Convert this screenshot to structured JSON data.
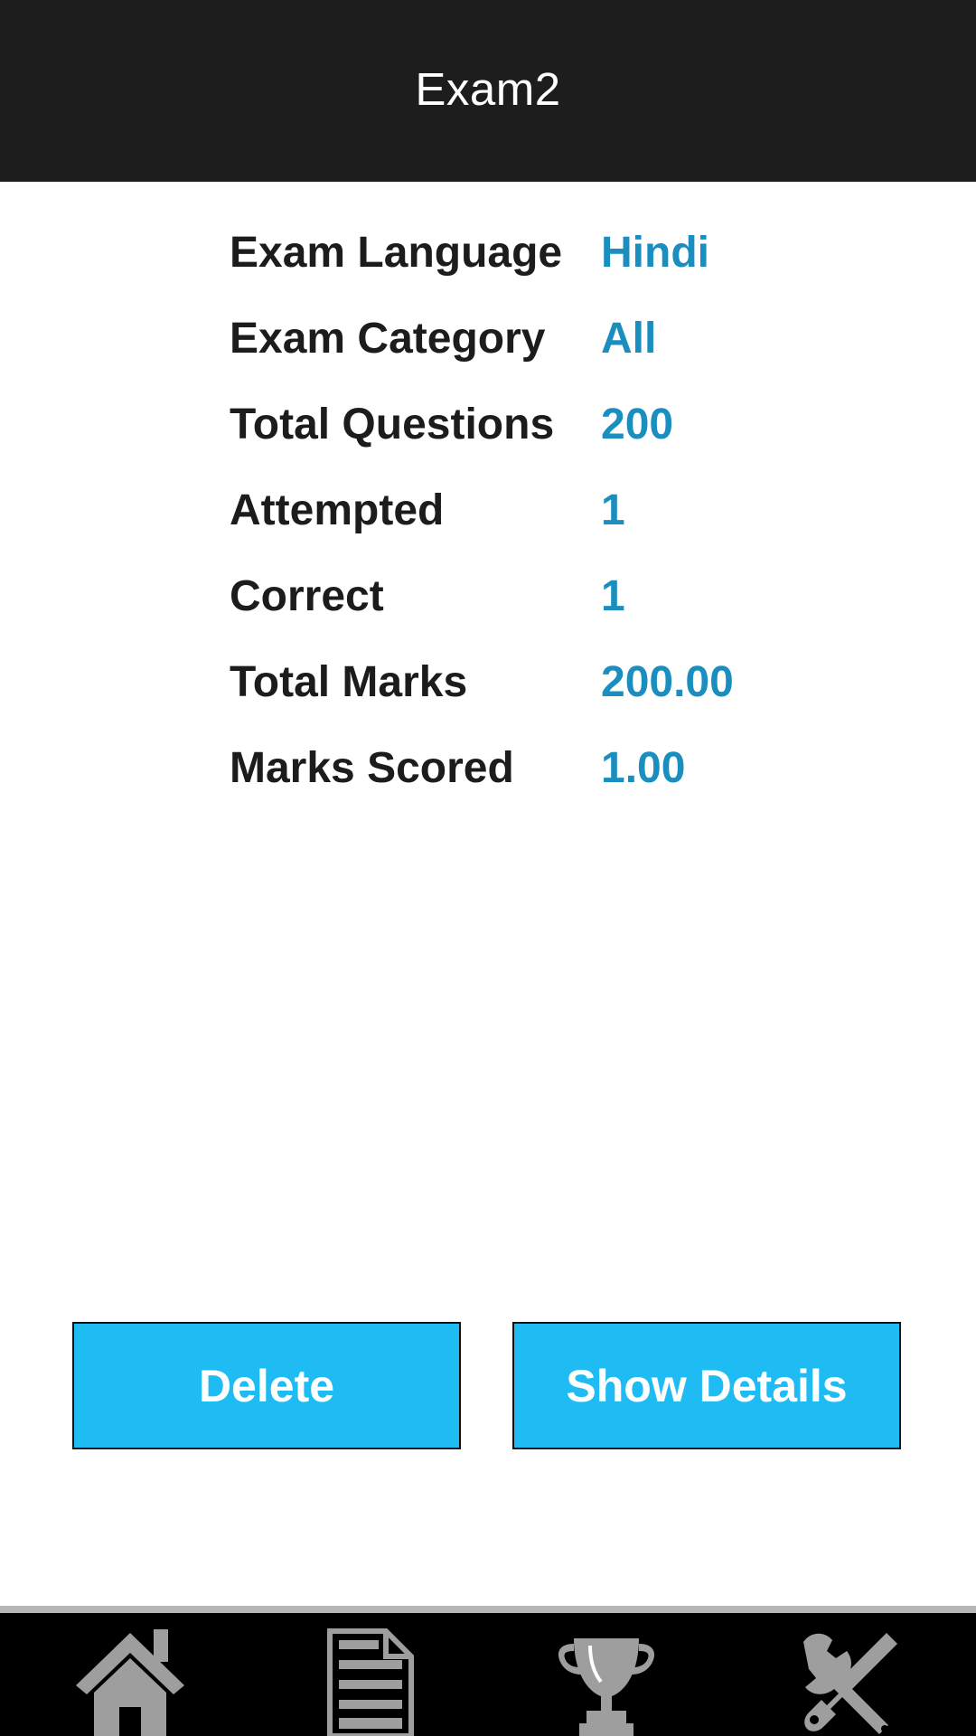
{
  "header": {
    "title": "Exam2"
  },
  "details": [
    {
      "label": "Exam Language",
      "value": "Hindi"
    },
    {
      "label": "Exam Category",
      "value": "All"
    },
    {
      "label": "Total Questions",
      "value": "200"
    },
    {
      "label": "Attempted",
      "value": "1"
    },
    {
      "label": "Correct",
      "value": "1"
    },
    {
      "label": "Total Marks",
      "value": "200.00"
    },
    {
      "label": "Marks Scored",
      "value": "1.00"
    }
  ],
  "actions": {
    "delete_label": "Delete",
    "show_details_label": "Show Details"
  },
  "bottom_nav": {
    "items": [
      {
        "icon": "home-icon"
      },
      {
        "icon": "document-icon"
      },
      {
        "icon": "trophy-icon"
      },
      {
        "icon": "tools-icon"
      }
    ]
  },
  "colors": {
    "header_bg": "#1d1d1d",
    "label_text": "#1c1c1c",
    "value_text": "#1a8fbf",
    "button_bg": "#1fbcf3",
    "nav_bg": "#000000",
    "nav_icon": "#9e9e9e"
  }
}
